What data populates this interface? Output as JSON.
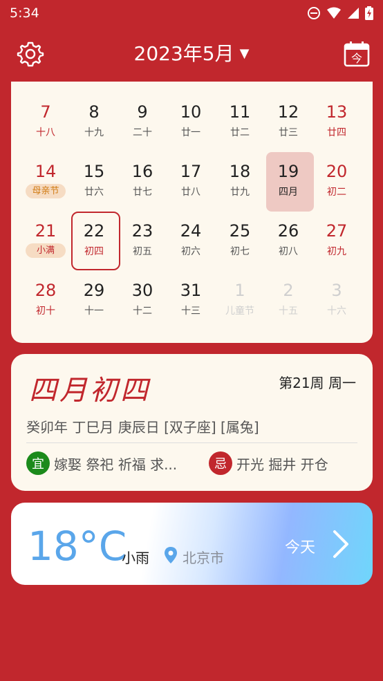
{
  "status_bar": {
    "time": "5:34"
  },
  "header": {
    "title": "2023年5月"
  },
  "calendar": {
    "rows": [
      [
        {
          "num": "7",
          "sub": "十八",
          "red": true
        },
        {
          "num": "8",
          "sub": "十九"
        },
        {
          "num": "9",
          "sub": "二十"
        },
        {
          "num": "10",
          "sub": "廿一"
        },
        {
          "num": "11",
          "sub": "廿二"
        },
        {
          "num": "12",
          "sub": "廿三"
        },
        {
          "num": "13",
          "sub": "廿四",
          "red": true
        }
      ],
      [
        {
          "num": "14",
          "sub": "母亲节",
          "red": true,
          "festival": true
        },
        {
          "num": "15",
          "sub": "廿六"
        },
        {
          "num": "16",
          "sub": "廿七"
        },
        {
          "num": "17",
          "sub": "廿八"
        },
        {
          "num": "18",
          "sub": "廿九"
        },
        {
          "num": "19",
          "sub": "四月",
          "selected": true
        },
        {
          "num": "20",
          "sub": "初二",
          "red": true
        }
      ],
      [
        {
          "num": "21",
          "sub": "小满",
          "red": true,
          "term": true
        },
        {
          "num": "22",
          "sub": "初四",
          "red_sub": true,
          "today": true
        },
        {
          "num": "23",
          "sub": "初五"
        },
        {
          "num": "24",
          "sub": "初六"
        },
        {
          "num": "25",
          "sub": "初七"
        },
        {
          "num": "26",
          "sub": "初八"
        },
        {
          "num": "27",
          "sub": "初九",
          "red": true
        }
      ],
      [
        {
          "num": "28",
          "sub": "初十",
          "red": true
        },
        {
          "num": "29",
          "sub": "十一"
        },
        {
          "num": "30",
          "sub": "十二"
        },
        {
          "num": "31",
          "sub": "十三"
        },
        {
          "num": "1",
          "sub": "儿童节",
          "dim": true
        },
        {
          "num": "2",
          "sub": "十五",
          "dim": true
        },
        {
          "num": "3",
          "sub": "十六",
          "dim": true
        }
      ]
    ]
  },
  "almanac": {
    "lunar_date": "四月初四",
    "week_info": "第21周 周一",
    "ganzhi": "癸卯年 丁巳月 庚辰日 [双子座] [属兔]",
    "yi_label": "宜",
    "yi_items": "嫁娶 祭祀 祈福 求...",
    "ji_label": "忌",
    "ji_items": "开光  掘井 开仓"
  },
  "weather": {
    "temperature": "18°C",
    "condition": "小雨",
    "city": "北京市",
    "today_label": "今天"
  },
  "icons": {
    "settings": "gear-icon",
    "today": "calendar-today-icon",
    "location": "location-pin-icon",
    "forward": "chevron-right-icon"
  },
  "colors": {
    "brand_red": "#c1272d",
    "card_bg": "#fdf8ee",
    "weather_blue": "#5aa6ea"
  }
}
